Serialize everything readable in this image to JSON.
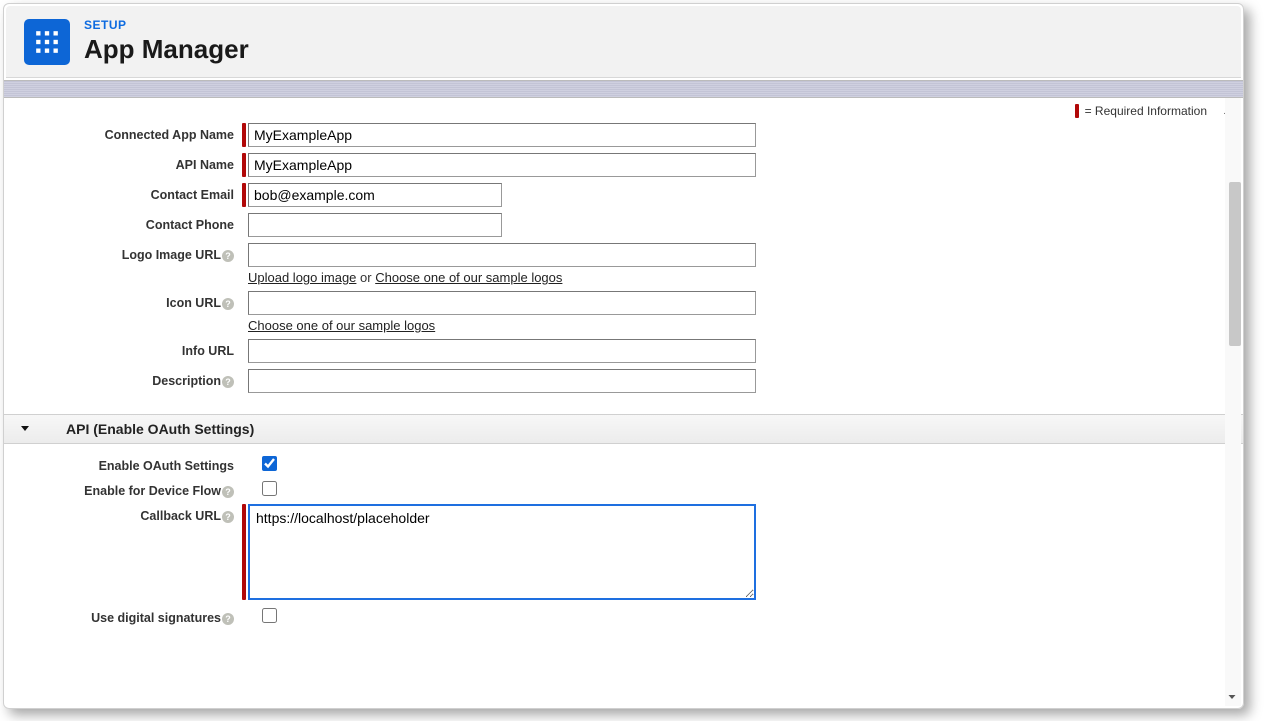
{
  "header": {
    "kicker": "SETUP",
    "title": "App Manager"
  },
  "requiredInfoLabel": "= Required Information",
  "fields": {
    "connectedAppName": {
      "label": "Connected App Name",
      "value": "MyExampleApp"
    },
    "apiName": {
      "label": "API Name",
      "value": "MyExampleApp"
    },
    "contactEmail": {
      "label": "Contact Email",
      "value": "bob@example.com"
    },
    "contactPhone": {
      "label": "Contact Phone",
      "value": ""
    },
    "logoImageUrl": {
      "label": "Logo Image URL",
      "value": ""
    },
    "iconUrl": {
      "label": "Icon URL",
      "value": ""
    },
    "infoUrl": {
      "label": "Info URL",
      "value": ""
    },
    "description": {
      "label": "Description",
      "value": ""
    }
  },
  "logoLinks": {
    "uploadLogoImage": "Upload logo image",
    "or": "or",
    "chooseSample": "Choose one of our sample logos"
  },
  "iconLinks": {
    "chooseSample": "Choose one of our sample logos"
  },
  "oauthSection": {
    "title": "API (Enable OAuth Settings)",
    "enableOAuth": {
      "label": "Enable OAuth Settings",
      "checked": true
    },
    "enableDeviceFlow": {
      "label": "Enable for Device Flow",
      "checked": false
    },
    "callbackUrl": {
      "label": "Callback URL",
      "value": "https://localhost/placeholder"
    },
    "useDigitalSigs": {
      "label": "Use digital signatures",
      "checked": false
    }
  }
}
